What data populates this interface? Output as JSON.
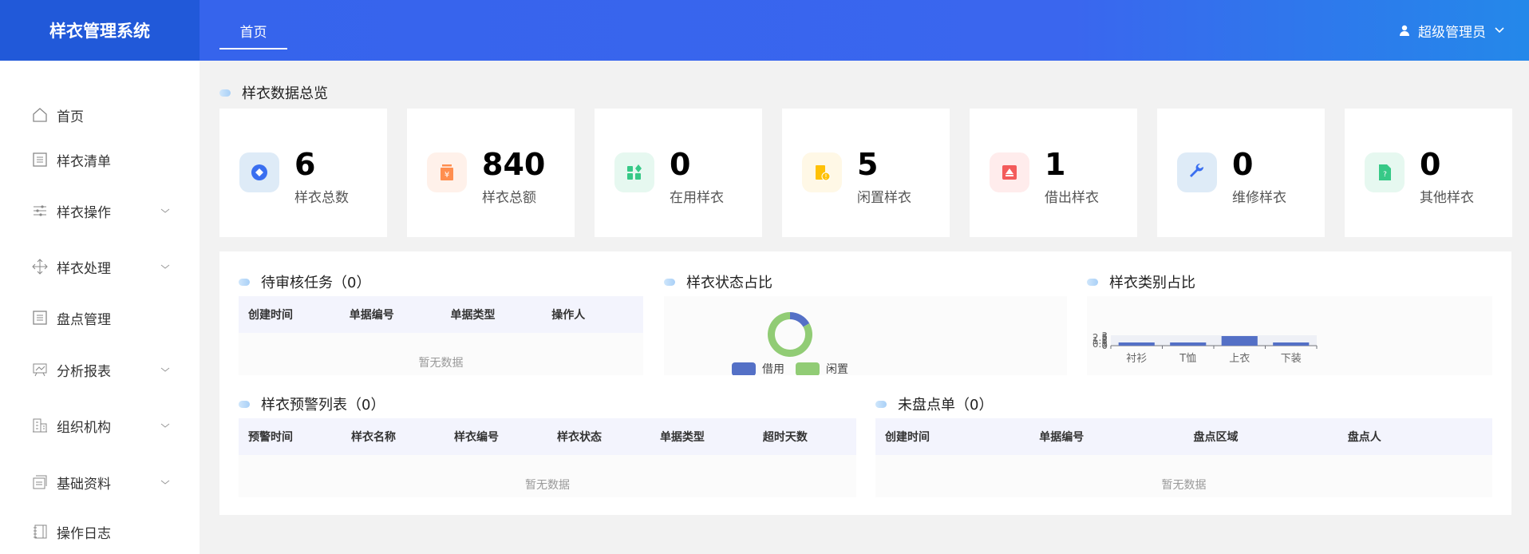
{
  "app_title": "样衣管理系统",
  "header": {
    "tab": "首页",
    "user": "超级管理员"
  },
  "sidebar": {
    "items": [
      {
        "label": "首页",
        "icon": "home-icon",
        "expandable": false
      },
      {
        "label": "样衣清单",
        "icon": "list-icon",
        "expandable": false
      },
      {
        "label": "样衣操作",
        "icon": "sliders-icon",
        "expandable": true
      },
      {
        "label": "样衣处理",
        "icon": "move-icon",
        "expandable": true
      },
      {
        "label": "盘点管理",
        "icon": "list-icon",
        "expandable": false
      },
      {
        "label": "分析报表",
        "icon": "chart-board-icon",
        "expandable": true
      },
      {
        "label": "组织机构",
        "icon": "building-icon",
        "expandable": true
      },
      {
        "label": "基础资料",
        "icon": "folder-icon",
        "expandable": true
      },
      {
        "label": "操作日志",
        "icon": "notebook-icon",
        "expandable": false
      }
    ]
  },
  "overview": {
    "title": "样衣数据总览",
    "cards": [
      {
        "value": "6",
        "label": "样衣总数",
        "icon": "diamond-coin-icon",
        "color": "#3a6ff0",
        "bg": "#deebf7"
      },
      {
        "value": "840",
        "label": "样衣总额",
        "icon": "yen-bag-icon",
        "color": "#ff8e4f",
        "bg": "#fff1ea"
      },
      {
        "value": "0",
        "label": "在用样衣",
        "icon": "apps-icon",
        "color": "#37c987",
        "bg": "#e6f8f0"
      },
      {
        "value": "5",
        "label": "闲置样衣",
        "icon": "idle-alert-icon",
        "color": "#ffc107",
        "bg": "#fff8e6"
      },
      {
        "value": "1",
        "label": "借出样衣",
        "icon": "lend-icon",
        "color": "#f35b5b",
        "bg": "#ffecec"
      },
      {
        "value": "0",
        "label": "维修样衣",
        "icon": "wrench-icon",
        "color": "#3a6ff0",
        "bg": "#deebf7"
      },
      {
        "value": "0",
        "label": "其他样衣",
        "icon": "question-doc-icon",
        "color": "#37c987",
        "bg": "#e6f8f0"
      }
    ]
  },
  "pending": {
    "title": "待审核任务（0）",
    "columns": [
      "创建时间",
      "单据编号",
      "单据类型",
      "操作人"
    ],
    "empty": "暂无数据"
  },
  "warning": {
    "title": "样衣预警列表（0）",
    "columns": [
      "预警时间",
      "样衣名称",
      "样衣编号",
      "样衣状态",
      "单据类型",
      "超时天数"
    ],
    "empty": "暂无数据"
  },
  "inventory": {
    "title": "未盘点单（0）",
    "columns": [
      "创建时间",
      "单据编号",
      "盘点区域",
      "盘点人"
    ],
    "empty": "暂无数据"
  },
  "chart_data": [
    {
      "type": "pie",
      "title": "样衣状态占比",
      "donut": true,
      "categories": [
        "借用",
        "闲置"
      ],
      "values": [
        1,
        5
      ],
      "colors": [
        "#5470c6",
        "#91cc75"
      ],
      "legend": "bottom"
    },
    {
      "type": "bar",
      "title": "样衣类别占比",
      "categories": [
        "衬衫",
        "T恤",
        "上衣",
        "下装"
      ],
      "values": [
        1,
        1,
        3,
        1
      ],
      "ylim": [
        0,
        3
      ],
      "yticks": [
        "0",
        "0.5",
        "1",
        "1.5",
        "2",
        "2.5",
        "3"
      ],
      "color": "#5470c6",
      "grid": true
    }
  ]
}
